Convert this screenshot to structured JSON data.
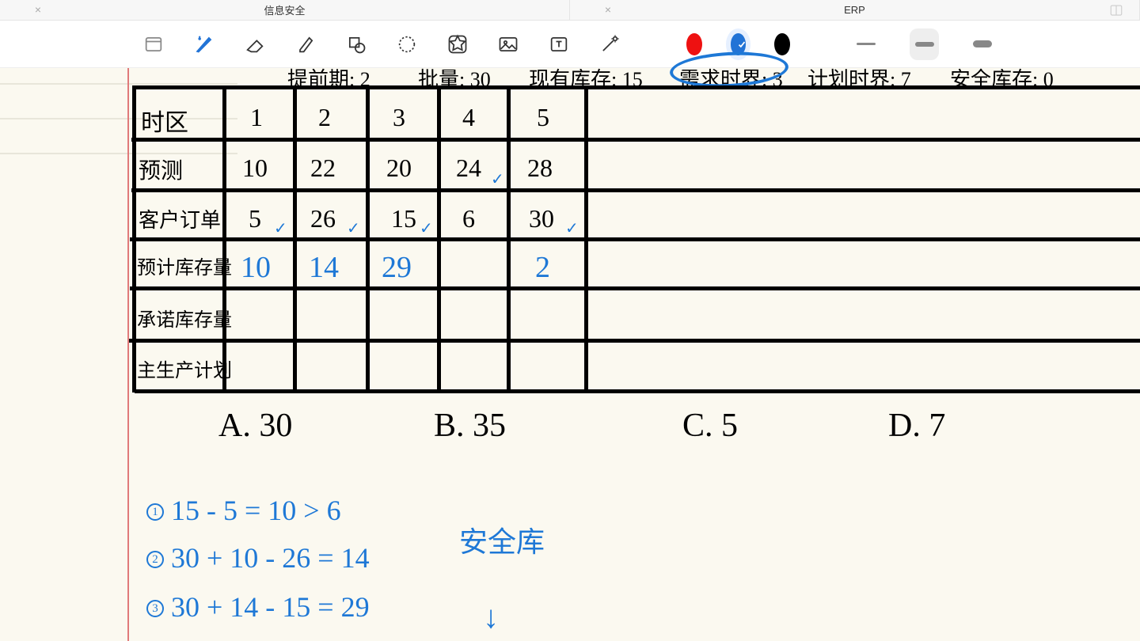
{
  "tabs": [
    {
      "title": "信息安全"
    },
    {
      "title": "ERP"
    }
  ],
  "colors": {
    "red": "#e11",
    "blue": "#2173d6",
    "black": "#000"
  },
  "header_params": {
    "lead_time_label": "提前期:",
    "lead_time": "2",
    "batch_label": "批量:",
    "batch": "30",
    "onhand_label": "现有库存:",
    "onhand": "15",
    "demand_fence_label": "需求时界:",
    "demand_fence": "3",
    "plan_fence_label": "计划时界:",
    "plan_fence": "7",
    "safety_label": "安全库存:",
    "safety": "0"
  },
  "rows": {
    "period_label": "时区",
    "forecast_label": "预测",
    "orders_label": "客户订单",
    "pab_label": "预计库存量",
    "atp_label": "承诺库存量",
    "mps_label": "主生产计划"
  },
  "table": {
    "periods": [
      "1",
      "2",
      "3",
      "4",
      "5"
    ],
    "forecast": [
      "10",
      "22",
      "20",
      "24",
      "28"
    ],
    "orders": [
      "5",
      "26",
      "15",
      "6",
      "30"
    ],
    "pab": [
      "10",
      "14",
      "29",
      "",
      "2"
    ]
  },
  "options": {
    "A": "30",
    "B": "35",
    "C": "5",
    "D": "7"
  },
  "work": {
    "line1": "15 - 5 = 10 > 6",
    "line2": "30 + 10 - 26 = 14",
    "line3": "30 + 14 - 15 = 29",
    "note": "安全库",
    "arrow": "↓"
  }
}
